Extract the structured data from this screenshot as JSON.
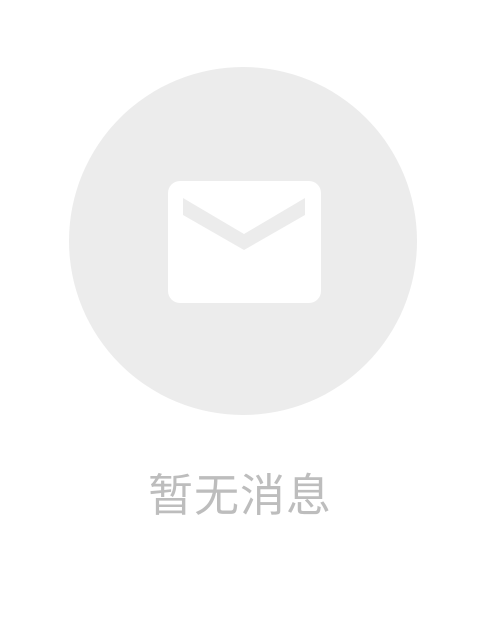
{
  "empty_state": {
    "icon": "mail-icon",
    "message": "暂无消息"
  },
  "colors": {
    "background": "#ffffff",
    "circle": "#ececec",
    "icon": "#ffffff",
    "text": "#bdbdbd"
  }
}
